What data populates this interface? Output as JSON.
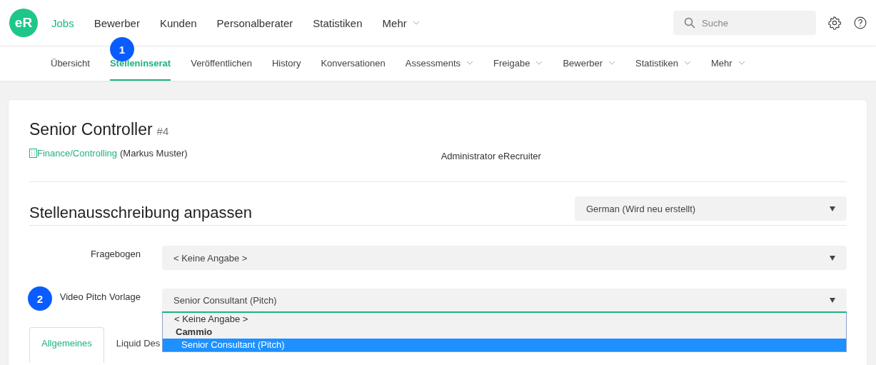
{
  "logo": {
    "text": "eR"
  },
  "main_nav": [
    {
      "label": "Jobs",
      "selected": true,
      "dropdown": false
    },
    {
      "label": "Bewerber",
      "selected": false,
      "dropdown": false
    },
    {
      "label": "Kunden",
      "selected": false,
      "dropdown": false
    },
    {
      "label": "Personalberater",
      "selected": false,
      "dropdown": false
    },
    {
      "label": "Statistiken",
      "selected": false,
      "dropdown": false
    },
    {
      "label": "Mehr",
      "selected": false,
      "dropdown": true
    }
  ],
  "search": {
    "placeholder": "Suche"
  },
  "sub_nav": [
    {
      "label": "Übersicht",
      "selected": false,
      "dropdown": false
    },
    {
      "label": "Stelleninserat",
      "selected": true,
      "dropdown": false,
      "badge": "1"
    },
    {
      "label": "Veröffentlichen",
      "selected": false,
      "dropdown": false
    },
    {
      "label": "History",
      "selected": false,
      "dropdown": false
    },
    {
      "label": "Konversationen",
      "selected": false,
      "dropdown": false
    },
    {
      "label": "Assessments",
      "selected": false,
      "dropdown": true
    },
    {
      "label": "Freigabe",
      "selected": false,
      "dropdown": true
    },
    {
      "label": "Bewerber",
      "selected": false,
      "dropdown": true
    },
    {
      "label": "Statistiken",
      "selected": false,
      "dropdown": true
    },
    {
      "label": "Mehr",
      "selected": false,
      "dropdown": true
    }
  ],
  "job": {
    "title": "Senior Controller",
    "number": "#4",
    "department": "Finance/Controlling",
    "contact": "(Markus Muster)",
    "admin": "Administrator eRecruiter"
  },
  "section": {
    "title": "Stellenausschreibung anpassen",
    "language_select": "German (Wird neu erstellt)"
  },
  "fields": [
    {
      "label": "Fragebogen",
      "value": "< Keine Angabe >",
      "open": false
    },
    {
      "label": "Video Pitch Vorlage",
      "value": "Senior Consultant (Pitch)",
      "open": true,
      "badge": "2",
      "options": [
        {
          "label": "< Keine Angabe >",
          "kind": "option",
          "selected": false
        },
        {
          "label": "Cammio",
          "kind": "group",
          "selected": false
        },
        {
          "label": "Senior Consultant (Pitch)",
          "kind": "option",
          "selected": true
        }
      ]
    }
  ],
  "tabs": [
    {
      "label": "Allgemeines",
      "selected": true
    },
    {
      "label": "Liquid Des",
      "selected": false
    }
  ]
}
